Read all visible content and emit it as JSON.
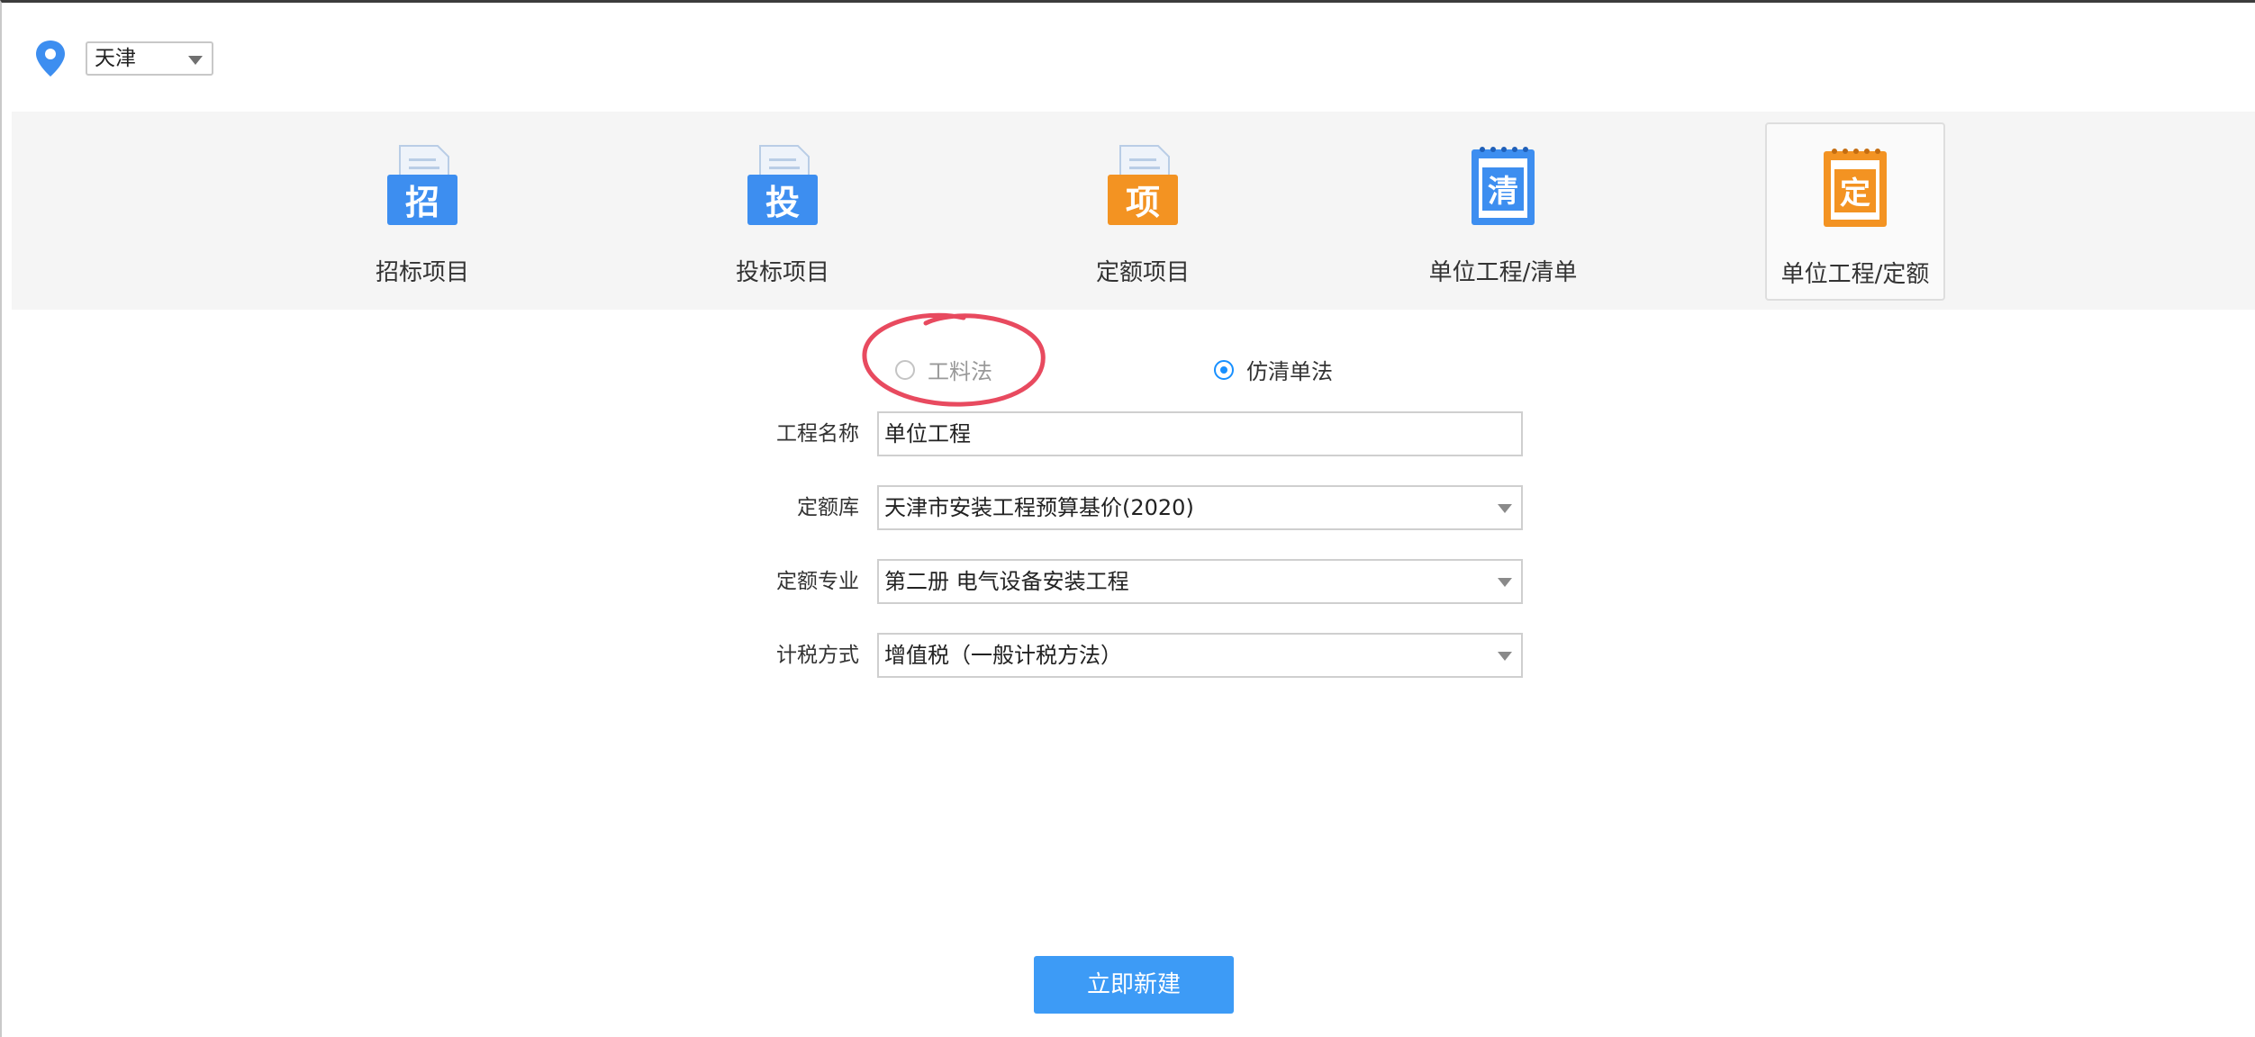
{
  "region": {
    "selected": "天津"
  },
  "project_types": [
    {
      "label": "招标项目",
      "icon_text": "招",
      "icon": "bid-invitation-doc-icon",
      "color": "#3d8ef0"
    },
    {
      "label": "投标项目",
      "icon_text": "投",
      "icon": "bid-submission-doc-icon",
      "color": "#3d8ef0"
    },
    {
      "label": "定额项目",
      "icon_text": "项",
      "icon": "quota-project-doc-icon",
      "color": "#f39322"
    },
    {
      "label": "单位工程/清单",
      "icon_text": "清",
      "icon": "bill-notebook-icon",
      "color": "#3d8ef0"
    },
    {
      "label": "单位工程/定额",
      "icon_text": "定",
      "icon": "quota-notebook-icon",
      "color": "#f39322",
      "active": true
    }
  ],
  "modes": {
    "option1": {
      "label": "工料法",
      "checked": false
    },
    "option2": {
      "label": "仿清单法",
      "checked": true
    }
  },
  "form": {
    "project_name": {
      "label": "工程名称",
      "value": "单位工程"
    },
    "quota_library": {
      "label": "定额库",
      "value": "天津市安装工程预算基价(2020)"
    },
    "quota_specialty": {
      "label": "定额专业",
      "value": "第二册 电气设备安装工程"
    },
    "tax_method": {
      "label": "计税方式",
      "value": "增值税（一般计税方法）"
    }
  },
  "actions": {
    "create_label": "立即新建"
  },
  "colors": {
    "accent": "#3d9bf6",
    "radio_checked": "#1890ff",
    "annotation": "#e84a5f"
  }
}
